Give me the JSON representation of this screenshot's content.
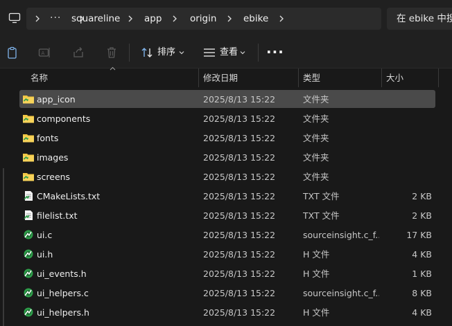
{
  "address_bar": {
    "breadcrumb": [
      {
        "label": "squareline"
      },
      {
        "label": "app"
      },
      {
        "label": "origin"
      },
      {
        "label": "ebike"
      }
    ],
    "overflow_label": "···",
    "search_placeholder": "在 ebike 中搜索"
  },
  "command_bar": {
    "sort_label": "排序",
    "view_label": "查看",
    "more_label": "···"
  },
  "columns": {
    "name": "名称",
    "date": "修改日期",
    "type": "类型",
    "size": "大小"
  },
  "files": [
    {
      "name": "app_icon",
      "date": "2025/8/13 15:22",
      "type": "文件夹",
      "size": "",
      "icon": "folder-icon",
      "selected": true
    },
    {
      "name": "components",
      "date": "2025/8/13 15:22",
      "type": "文件夹",
      "size": "",
      "icon": "folder-icon"
    },
    {
      "name": "fonts",
      "date": "2025/8/13 15:22",
      "type": "文件夹",
      "size": "",
      "icon": "folder-icon"
    },
    {
      "name": "images",
      "date": "2025/8/13 15:22",
      "type": "文件夹",
      "size": "",
      "icon": "folder-icon"
    },
    {
      "name": "screens",
      "date": "2025/8/13 15:22",
      "type": "文件夹",
      "size": "",
      "icon": "folder-icon"
    },
    {
      "name": "CMakeLists.txt",
      "date": "2025/8/13 15:22",
      "type": "TXT 文件",
      "size": "2 KB",
      "icon": "text-file-icon"
    },
    {
      "name": "filelist.txt",
      "date": "2025/8/13 15:22",
      "type": "TXT 文件",
      "size": "2 KB",
      "icon": "text-file-icon"
    },
    {
      "name": "ui.c",
      "date": "2025/8/13 15:22",
      "type": "sourceinsight.c_f...",
      "size": "17 KB",
      "icon": "source-file-icon"
    },
    {
      "name": "ui.h",
      "date": "2025/8/13 15:22",
      "type": "H 文件",
      "size": "4 KB",
      "icon": "source-file-icon"
    },
    {
      "name": "ui_events.h",
      "date": "2025/8/13 15:22",
      "type": "H 文件",
      "size": "1 KB",
      "icon": "source-file-icon"
    },
    {
      "name": "ui_helpers.c",
      "date": "2025/8/13 15:22",
      "type": "sourceinsight.c_f...",
      "size": "8 KB",
      "icon": "source-file-icon"
    },
    {
      "name": "ui_helpers.h",
      "date": "2025/8/13 15:22",
      "type": "H 文件",
      "size": "4 KB",
      "icon": "source-file-icon"
    }
  ],
  "colors": {
    "background": "#191919",
    "toolbar": "#202020",
    "selected_row": "#4a4a4a",
    "folder": "#f2c744"
  }
}
